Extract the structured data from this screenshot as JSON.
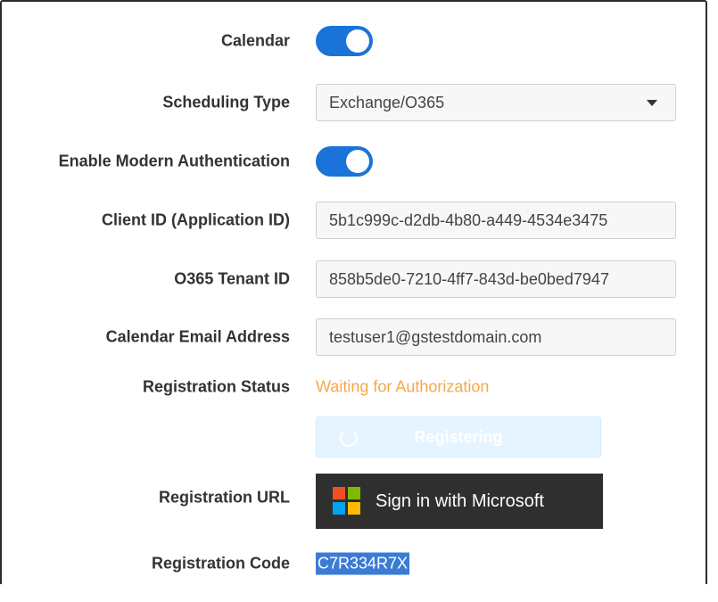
{
  "form": {
    "calendar": {
      "label": "Calendar",
      "enabled": true
    },
    "scheduling_type": {
      "label": "Scheduling Type",
      "value": "Exchange/O365"
    },
    "modern_auth": {
      "label": "Enable Modern Authentication",
      "enabled": true
    },
    "client_id": {
      "label": "Client ID (Application ID)",
      "value": "5b1c999c-d2db-4b80-a449-4534e3475"
    },
    "tenant_id": {
      "label": "O365 Tenant ID",
      "value": "858b5de0-7210-4ff7-843d-be0bed7947"
    },
    "email": {
      "label": "Calendar Email Address",
      "value": "testuser1@gstestdomain.com"
    },
    "registration_status": {
      "label": "Registration Status",
      "value": "Waiting for Authorization"
    },
    "registering_button": {
      "label": "Registering"
    },
    "registration_url": {
      "label": "Registration URL",
      "button_label": "Sign in with Microsoft"
    },
    "registration_code": {
      "label": "Registration Code",
      "value": "C7R334R7X"
    }
  },
  "colors": {
    "toggle_on": "#1a73d9",
    "status_waiting": "#f4a84a",
    "ms_button_bg": "#2f2f2f",
    "ms_red": "#f25022",
    "ms_green": "#7fba00",
    "ms_blue": "#00a4ef",
    "ms_yellow": "#ffb900",
    "selection_highlight": "#3b7bd4"
  },
  "icons": {
    "caret": "chevron-down-icon",
    "spinner": "spinner-icon",
    "microsoft": "microsoft-logo-icon"
  }
}
